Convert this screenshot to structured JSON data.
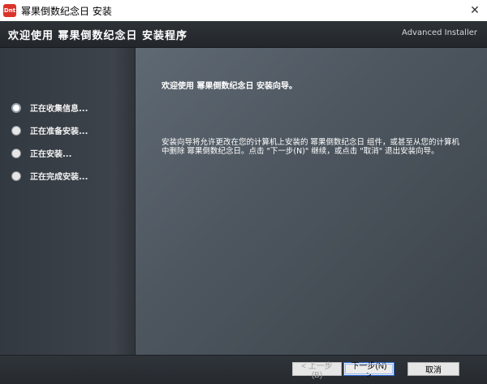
{
  "window": {
    "title": "幂果倒数纪念日 安装",
    "app_icon_text": "Dnt",
    "close_glyph": "✕"
  },
  "header": {
    "title": "欢迎使用 幂果倒数纪念日 安装程序",
    "brand": "Advanced Installer"
  },
  "sidebar": {
    "steps": [
      {
        "label": "正在收集信息...",
        "active": true
      },
      {
        "label": "正在准备安装...",
        "active": false
      },
      {
        "label": "正在安装...",
        "active": false
      },
      {
        "label": "正在完成安装...",
        "active": false
      }
    ]
  },
  "content": {
    "welcome": "欢迎使用 幂果倒数纪念日 安装向导。",
    "description": "安装向导将允许更改在您的计算机上安装的 幂果倒数纪念日 组件，或甚至从您的计算机中删除 幂果倒数纪念日。点击 \"下一步(N)\" 继续，或点击 \"取消\" 退出安装向导。"
  },
  "footer": {
    "back_label": "< 上一步(B)",
    "next_label": "下一步(N) >",
    "cancel_label": "取消"
  },
  "colors": {
    "background": "#3c4249",
    "accent_focus": "#2a6bd8"
  }
}
